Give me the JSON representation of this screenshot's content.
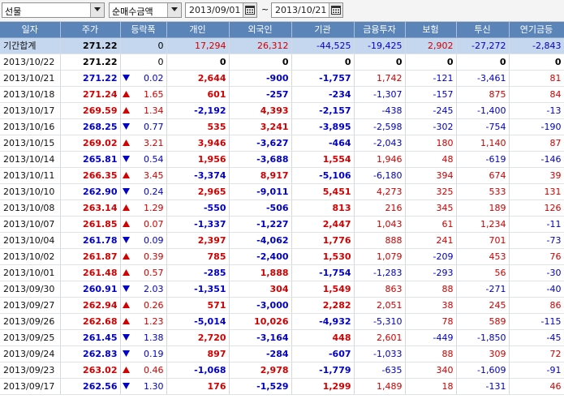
{
  "toolbar": {
    "market": "선물",
    "metric": "순매수금액",
    "date_from": "2013/09/01",
    "date_to": "2013/10/21",
    "range_separator": "~"
  },
  "headers": [
    "일자",
    "주가",
    "등락폭",
    "개인",
    "외국인",
    "기관",
    "금융투자",
    "보험",
    "투신",
    "연기금등"
  ],
  "total": {
    "label": "기간합계",
    "price": "271.22",
    "change": "0",
    "individual": "17,294",
    "foreign": "26,312",
    "institution": "-44,525",
    "financial": "-19,425",
    "insurance": "2,902",
    "trust": "-27,272",
    "pension": "-2,843"
  },
  "rows": [
    {
      "date": "2013/10/22",
      "price": "271.22",
      "dir": "none",
      "change": "0",
      "individual": "0",
      "foreign": "0",
      "institution": "0",
      "financial": "0",
      "insurance": "0",
      "trust": "0",
      "pension": "0"
    },
    {
      "date": "2013/10/21",
      "price": "271.22",
      "dir": "down",
      "change": "0.02",
      "individual": "2,644",
      "foreign": "-900",
      "institution": "-1,757",
      "financial": "1,742",
      "insurance": "-121",
      "trust": "-3,461",
      "pension": "81"
    },
    {
      "date": "2013/10/18",
      "price": "271.24",
      "dir": "up",
      "change": "1.65",
      "individual": "601",
      "foreign": "-257",
      "institution": "-234",
      "financial": "-1,307",
      "insurance": "-157",
      "trust": "875",
      "pension": "84"
    },
    {
      "date": "2013/10/17",
      "price": "269.59",
      "dir": "up",
      "change": "1.34",
      "individual": "-2,192",
      "foreign": "4,393",
      "institution": "-2,157",
      "financial": "-438",
      "insurance": "-245",
      "trust": "-1,400",
      "pension": "-13"
    },
    {
      "date": "2013/10/16",
      "price": "268.25",
      "dir": "down",
      "change": "0.77",
      "individual": "535",
      "foreign": "3,241",
      "institution": "-3,895",
      "financial": "-2,598",
      "insurance": "-302",
      "trust": "-754",
      "pension": "-190"
    },
    {
      "date": "2013/10/15",
      "price": "269.02",
      "dir": "up",
      "change": "3.21",
      "individual": "3,946",
      "foreign": "-3,627",
      "institution": "-464",
      "financial": "-2,043",
      "insurance": "180",
      "trust": "1,140",
      "pension": "87"
    },
    {
      "date": "2013/10/14",
      "price": "265.81",
      "dir": "down",
      "change": "0.54",
      "individual": "1,956",
      "foreign": "-3,688",
      "institution": "1,554",
      "financial": "1,946",
      "insurance": "48",
      "trust": "-619",
      "pension": "-146"
    },
    {
      "date": "2013/10/11",
      "price": "266.35",
      "dir": "up",
      "change": "3.45",
      "individual": "-3,374",
      "foreign": "8,917",
      "institution": "-5,106",
      "financial": "-6,180",
      "insurance": "394",
      "trust": "674",
      "pension": "39"
    },
    {
      "date": "2013/10/10",
      "price": "262.90",
      "dir": "down",
      "change": "0.24",
      "individual": "2,965",
      "foreign": "-9,011",
      "institution": "5,451",
      "financial": "4,273",
      "insurance": "325",
      "trust": "533",
      "pension": "131"
    },
    {
      "date": "2013/10/08",
      "price": "263.14",
      "dir": "up",
      "change": "1.29",
      "individual": "-550",
      "foreign": "-506",
      "institution": "813",
      "financial": "216",
      "insurance": "345",
      "trust": "189",
      "pension": "126"
    },
    {
      "date": "2013/10/07",
      "price": "261.85",
      "dir": "up",
      "change": "0.07",
      "individual": "-1,337",
      "foreign": "-1,227",
      "institution": "2,447",
      "financial": "1,043",
      "insurance": "61",
      "trust": "1,234",
      "pension": "-11"
    },
    {
      "date": "2013/10/04",
      "price": "261.78",
      "dir": "down",
      "change": "0.09",
      "individual": "2,397",
      "foreign": "-4,062",
      "institution": "1,776",
      "financial": "888",
      "insurance": "241",
      "trust": "701",
      "pension": "-73"
    },
    {
      "date": "2013/10/02",
      "price": "261.87",
      "dir": "up",
      "change": "0.39",
      "individual": "785",
      "foreign": "-2,400",
      "institution": "1,530",
      "financial": "1,079",
      "insurance": "-209",
      "trust": "453",
      "pension": "76"
    },
    {
      "date": "2013/10/01",
      "price": "261.48",
      "dir": "up",
      "change": "0.57",
      "individual": "-285",
      "foreign": "1,888",
      "institution": "-1,754",
      "financial": "-1,283",
      "insurance": "-293",
      "trust": "56",
      "pension": "-30"
    },
    {
      "date": "2013/09/30",
      "price": "260.91",
      "dir": "down",
      "change": "2.03",
      "individual": "-1,351",
      "foreign": "304",
      "institution": "1,549",
      "financial": "863",
      "insurance": "88",
      "trust": "-271",
      "pension": "-40"
    },
    {
      "date": "2013/09/27",
      "price": "262.94",
      "dir": "up",
      "change": "0.26",
      "individual": "571",
      "foreign": "-3,000",
      "institution": "2,282",
      "financial": "2,051",
      "insurance": "38",
      "trust": "245",
      "pension": "86"
    },
    {
      "date": "2013/09/26",
      "price": "262.68",
      "dir": "up",
      "change": "1.23",
      "individual": "-5,014",
      "foreign": "10,026",
      "institution": "-4,932",
      "financial": "-5,310",
      "insurance": "78",
      "trust": "589",
      "pension": "-115"
    },
    {
      "date": "2013/09/25",
      "price": "261.45",
      "dir": "down",
      "change": "1.38",
      "individual": "2,720",
      "foreign": "-3,164",
      "institution": "448",
      "financial": "2,601",
      "insurance": "-449",
      "trust": "-1,850",
      "pension": "-45"
    },
    {
      "date": "2013/09/24",
      "price": "262.83",
      "dir": "down",
      "change": "0.19",
      "individual": "897",
      "foreign": "-284",
      "institution": "-607",
      "financial": "-1,033",
      "insurance": "88",
      "trust": "309",
      "pension": "72"
    },
    {
      "date": "2013/09/23",
      "price": "263.02",
      "dir": "up",
      "change": "0.46",
      "individual": "-1,068",
      "foreign": "2,978",
      "institution": "-1,779",
      "financial": "-635",
      "insurance": "340",
      "trust": "-1,609",
      "pension": "-91"
    },
    {
      "date": "2013/09/17",
      "price": "262.56",
      "dir": "down",
      "change": "1.30",
      "individual": "176",
      "foreign": "-1,529",
      "institution": "1,299",
      "financial": "1,489",
      "insurance": "18",
      "trust": "-131",
      "pension": "46"
    }
  ],
  "colors": {
    "header_bg": "#5b84b8",
    "total_bg": "#c4d7ef",
    "up": "#d20000",
    "down": "#0000c8"
  },
  "icons": {
    "dropdown": "chevron-down-icon",
    "calendar": "calendar-icon",
    "up": "triangle-up-icon",
    "down": "triangle-down-icon"
  }
}
